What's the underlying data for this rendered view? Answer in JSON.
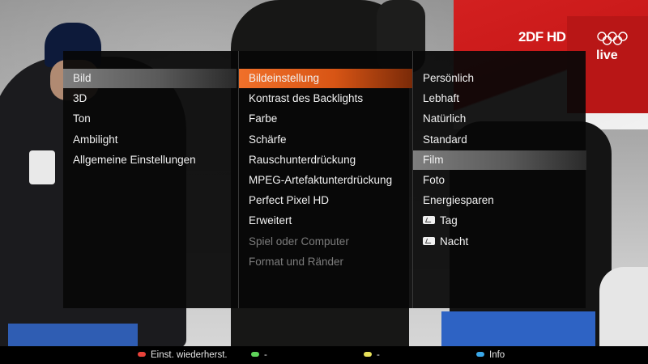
{
  "broadcaster": {
    "logo_text": "2DF HD",
    "status": "live"
  },
  "menu": {
    "column1": {
      "items": [
        {
          "label": "Bild",
          "state": "selected"
        },
        {
          "label": "3D",
          "state": "normal"
        },
        {
          "label": "Ton",
          "state": "normal"
        },
        {
          "label": "Ambilight",
          "state": "normal"
        },
        {
          "label": "Allgemeine Einstellungen",
          "state": "normal"
        }
      ]
    },
    "column2": {
      "items": [
        {
          "label": "Bildeinstellung",
          "state": "highlighted"
        },
        {
          "label": "Kontrast des Backlights",
          "state": "normal"
        },
        {
          "label": "Farbe",
          "state": "normal"
        },
        {
          "label": "Schärfe",
          "state": "normal"
        },
        {
          "label": "Rauschunterdrückung",
          "state": "normal"
        },
        {
          "label": "MPEG-Artefaktunterdrückung",
          "state": "normal"
        },
        {
          "label": "Perfect Pixel HD",
          "state": "normal"
        },
        {
          "label": "Erweitert",
          "state": "normal"
        },
        {
          "label": "Spiel oder Computer",
          "state": "disabled"
        },
        {
          "label": "Format und Ränder",
          "state": "disabled"
        }
      ]
    },
    "column3": {
      "items": [
        {
          "label": "Persönlich",
          "state": "normal",
          "icon": ""
        },
        {
          "label": "Lebhaft",
          "state": "normal",
          "icon": ""
        },
        {
          "label": "Natürlich",
          "state": "normal",
          "icon": ""
        },
        {
          "label": "Standard",
          "state": "normal",
          "icon": ""
        },
        {
          "label": "Film",
          "state": "selected",
          "icon": ""
        },
        {
          "label": "Foto",
          "state": "normal",
          "icon": ""
        },
        {
          "label": "Energiesparen",
          "state": "normal",
          "icon": ""
        },
        {
          "label": "Tag",
          "state": "normal",
          "icon": "isf-tag-icon"
        },
        {
          "label": "Nacht",
          "state": "normal",
          "icon": "isf-tag-icon"
        }
      ]
    }
  },
  "footer": {
    "keys": [
      {
        "color": "#e8423a",
        "label": "Einst. wiederherst."
      },
      {
        "color": "#5fd35a",
        "label": "-"
      },
      {
        "color": "#e8e15a",
        "label": "-"
      },
      {
        "color": "#3aa7e8",
        "label": "Info"
      }
    ]
  }
}
